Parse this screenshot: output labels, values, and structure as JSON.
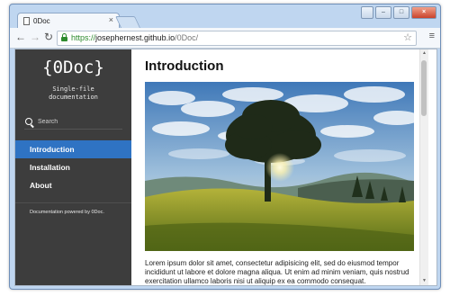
{
  "browser": {
    "tab_title": "0Doc",
    "tab_close": "×",
    "url_scheme": "https://",
    "url_host": "josephernest.github.io",
    "url_path": "/0Doc/",
    "nav": {
      "back": "←",
      "forward": "→",
      "reload": "↻"
    },
    "star": "☆",
    "menu": "≡"
  },
  "sidebar": {
    "logo": "{0Doc}",
    "tagline": "Single-file\ndocumentation",
    "search_placeholder": "Search",
    "items": [
      {
        "label": "Introduction",
        "active": true
      },
      {
        "label": "Installation",
        "active": false
      },
      {
        "label": "About",
        "active": false
      }
    ],
    "footer": "Documentation powered by 0Doc."
  },
  "main": {
    "title": "Introduction",
    "paragraph": "Lorem ipsum dolor sit amet, consectetur adipisicing elit, sed do eiusmod tempor incididunt ut labore et dolore magna aliqua. Ut enim ad minim veniam, quis nostrud exercitation ullamco laboris nisi ut aliquip ex ea commodo consequat."
  },
  "colors": {
    "sidebar_bg": "#3d3d3d",
    "active_item": "#2f73c3",
    "secure_green": "#2e8b2e"
  }
}
